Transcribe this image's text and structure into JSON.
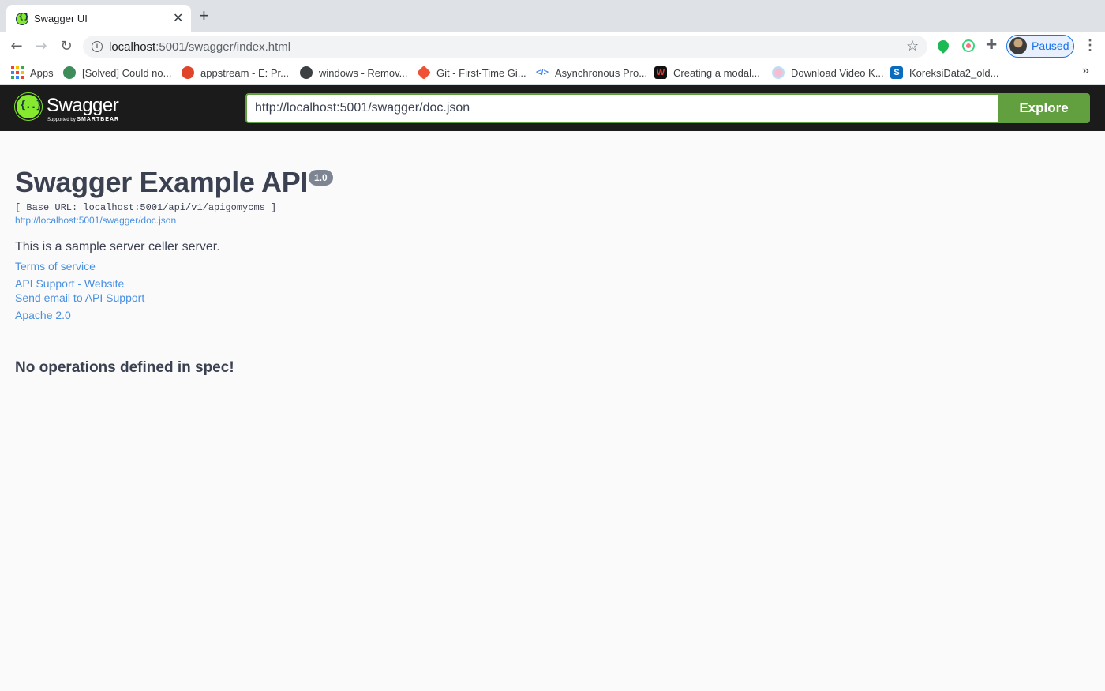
{
  "browser": {
    "tab_title": "Swagger UI",
    "tab_close": "✕",
    "new_tab": "+",
    "url_host": "localhost",
    "url_path": ":5001/swagger/index.html",
    "profile_label": "Paused",
    "bookmarks": [
      {
        "label": "Apps",
        "icon": "apps-grid-icon"
      },
      {
        "label": "[Solved] Could no...",
        "icon": "gear-favicon"
      },
      {
        "label": "appstream - E: Pr...",
        "icon": "ask-favicon"
      },
      {
        "label": "windows - Remov...",
        "icon": "globe-favicon"
      },
      {
        "label": "Git - First-Time Gi...",
        "icon": "git-favicon"
      },
      {
        "label": "Asynchronous Pro...",
        "icon": "code-favicon"
      },
      {
        "label": "Creating a modal...",
        "icon": "w-favicon"
      },
      {
        "label": "Download Video K...",
        "icon": "circle-favicon"
      },
      {
        "label": "KoreksiData2_old...",
        "icon": "sharepoint-favicon"
      }
    ],
    "bookmarks_more": "»"
  },
  "topbar": {
    "logo_word": "Swagger",
    "logo_sub_prefix": "Supported by ",
    "logo_sub_brand": "SMARTBEAR",
    "spec_url": "http://localhost:5001/swagger/doc.json",
    "explore_label": "Explore"
  },
  "info": {
    "title": "Swagger Example API",
    "version": "1.0",
    "base_url": "[ Base URL: localhost:5001/api/v1/apigomycms ]",
    "spec_link": "http://localhost:5001/swagger/doc.json",
    "description": "This is a sample server celler server.",
    "terms": "Terms of service",
    "support_website": "API Support - Website",
    "support_email": "Send email to API Support",
    "license": "Apache 2.0"
  },
  "operations": {
    "empty_message": "No operations defined in spec!"
  },
  "colors": {
    "accent_green": "#62a03f",
    "logo_green": "#85ea2d",
    "link_blue": "#4990e2",
    "text": "#3b4151",
    "topbar_bg": "#1b1b1b"
  }
}
